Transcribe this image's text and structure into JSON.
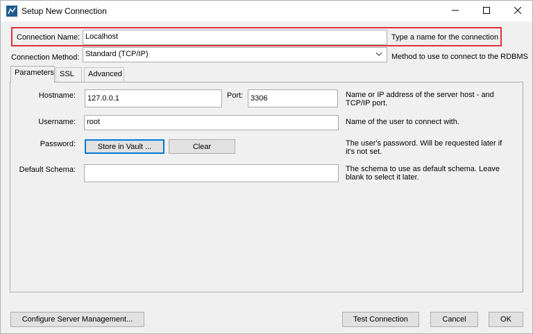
{
  "window": {
    "title": "Setup New Connection"
  },
  "connection_name": {
    "label": "Connection Name:",
    "value": "Localhost",
    "help": "Type a name for the connection"
  },
  "connection_method": {
    "label": "Connection Method:",
    "value": "Standard (TCP/IP)",
    "help": "Method to use to connect to the RDBMS"
  },
  "tabs": [
    {
      "label": "Parameters",
      "active": true
    },
    {
      "label": "SSL",
      "active": false
    },
    {
      "label": "Advanced",
      "active": false
    }
  ],
  "parameters": {
    "hostname": {
      "label": "Hostname:",
      "value": "127.0.0.1",
      "help": "Name or IP address of the server host - and TCP/IP port."
    },
    "port": {
      "label": "Port:",
      "value": "3306"
    },
    "username": {
      "label": "Username:",
      "value": "root",
      "help": "Name of the user to connect with."
    },
    "password": {
      "label": "Password:",
      "store_button": "Store in Vault ...",
      "clear_button": "Clear",
      "help": "The user's password. Will be requested later if it's not set."
    },
    "default_schema": {
      "label": "Default Schema:",
      "value": "",
      "help": "The schema to use as default schema. Leave blank to select it later."
    }
  },
  "footer": {
    "configure_button": "Configure Server Management...",
    "test_button": "Test Connection",
    "cancel_button": "Cancel",
    "ok_button": "OK"
  },
  "colors": {
    "highlight_border": "#e0303a",
    "focus_border": "#0078d7",
    "app_icon": "#1f5a8c"
  },
  "icons": {
    "app": "mysql-workbench-icon",
    "minimize": "minimize-icon",
    "maximize": "maximize-icon",
    "close": "close-icon",
    "dropdown": "chevron-down-icon"
  }
}
